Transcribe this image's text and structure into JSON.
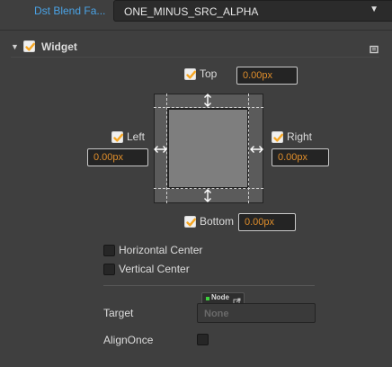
{
  "blend": {
    "label": "Dst Blend Fa...",
    "value": "ONE_MINUS_SRC_ALPHA",
    "dropdown_icon": "triangle-down"
  },
  "widget": {
    "title": "Widget",
    "enabled": true,
    "top": {
      "label": "Top",
      "checked": true,
      "value": "0.00px"
    },
    "left": {
      "label": "Left",
      "checked": true,
      "value": "0.00px"
    },
    "right": {
      "label": "Right",
      "checked": true,
      "value": "0.00px"
    },
    "bottom": {
      "label": "Bottom",
      "checked": true,
      "value": "0.00px"
    },
    "horizontal_center": {
      "label": "Horizontal Center",
      "checked": false
    },
    "vertical_center": {
      "label": "Vertical Center",
      "checked": false
    },
    "target": {
      "label": "Target",
      "tag": "Node",
      "placeholder": "None"
    },
    "align_once": {
      "label": "AlignOnce",
      "checked": false
    }
  },
  "colors": {
    "accent": "#f5a623",
    "link": "#4aa3e6",
    "value_text": "#e08e2b",
    "node_tag_dot": "#3ecf3e"
  }
}
